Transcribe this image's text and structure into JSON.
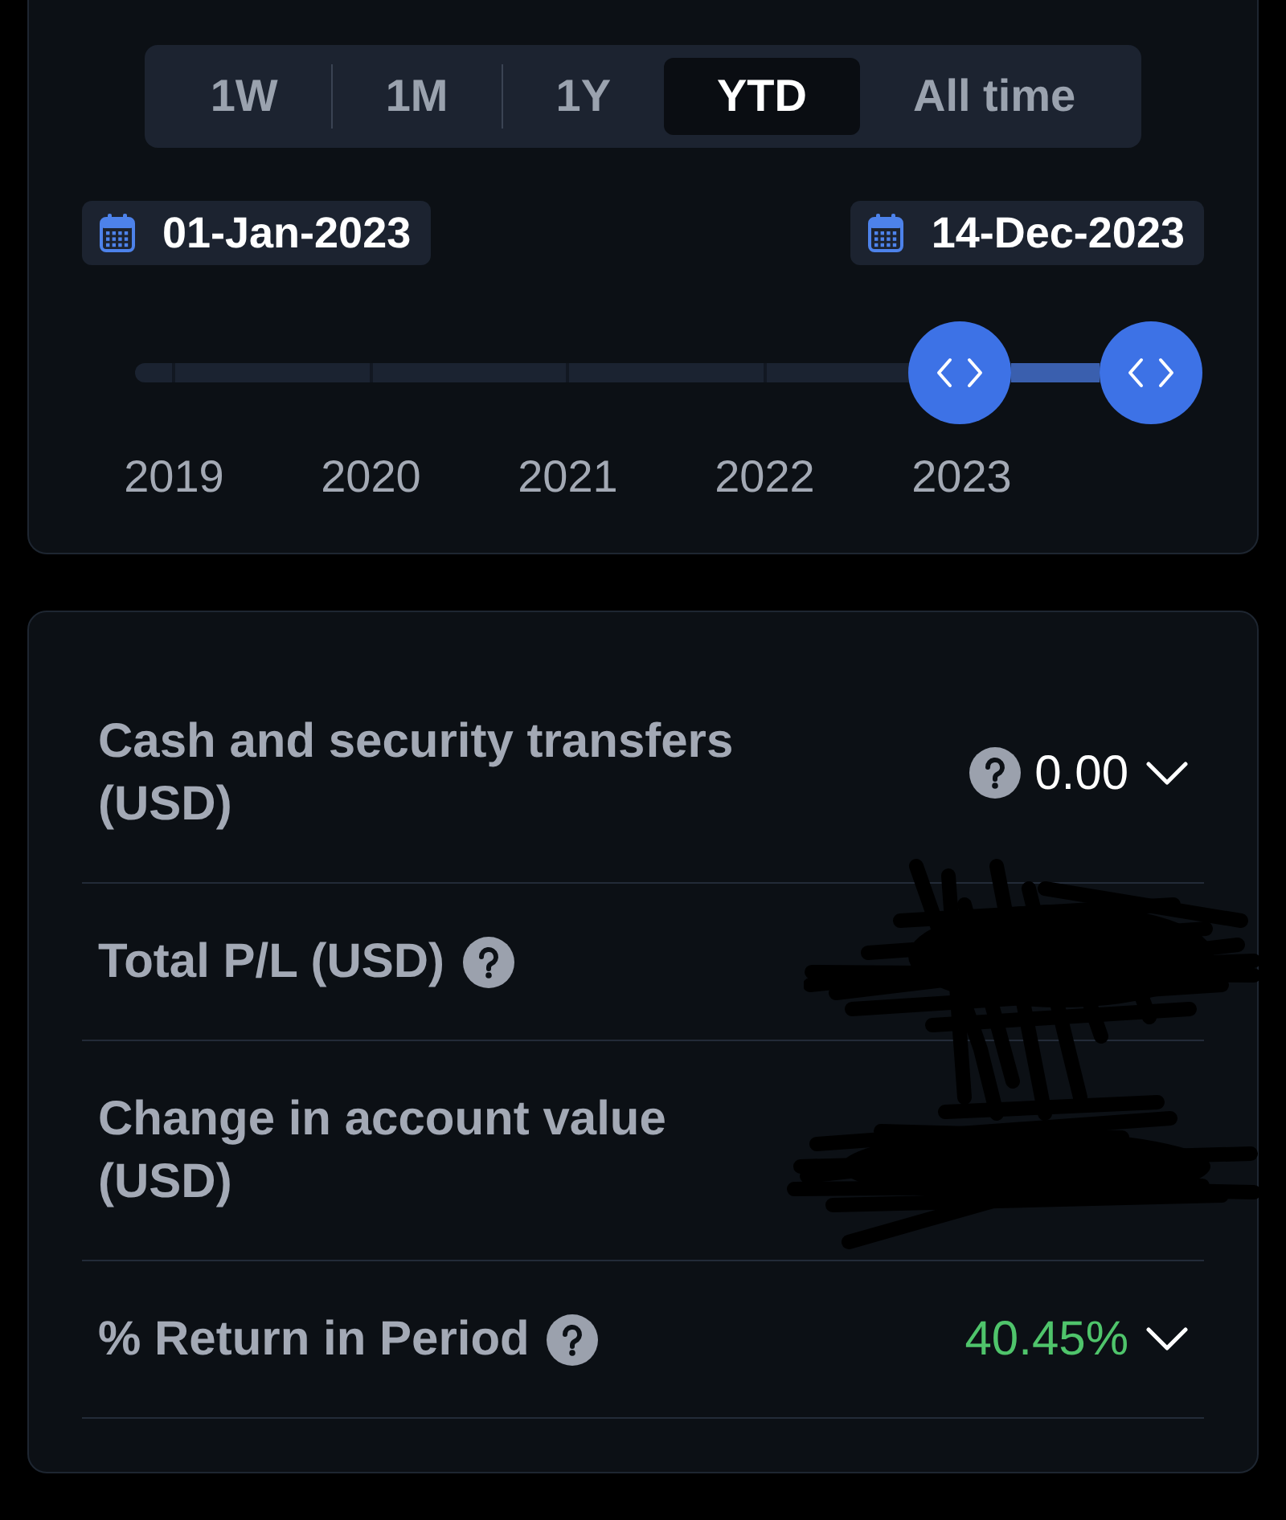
{
  "range_tabs": [
    {
      "label": "1W",
      "selected": false
    },
    {
      "label": "1M",
      "selected": false
    },
    {
      "label": "1Y",
      "selected": false
    },
    {
      "label": "YTD",
      "selected": true
    },
    {
      "label": "All time",
      "selected": false
    }
  ],
  "date_range": {
    "start": "01-Jan-2023",
    "end": "14-Dec-2023"
  },
  "timeline": {
    "thumbs": [
      {
        "level": 0.78
      },
      {
        "level": 0.96
      }
    ],
    "years": [
      "2019",
      "2020",
      "2021",
      "2022",
      "2023"
    ]
  },
  "metrics": [
    {
      "label": "Cash and security transfers (USD)",
      "label_help": false,
      "value_help": true,
      "value": "0.00",
      "color": "#ffffff",
      "expandable": true,
      "redacted": false
    },
    {
      "label": "Total P/L (USD)",
      "label_help": true,
      "value_help": false,
      "expandable": false,
      "redacted": true
    },
    {
      "label": "Change in account value (USD)",
      "label_help": false,
      "value_help": false,
      "expandable": false,
      "redacted": true
    },
    {
      "label": "% Return in Period",
      "label_help": true,
      "value_help": false,
      "value": "40.45%",
      "color": "#4fc46b",
      "expandable": true,
      "redacted": false
    }
  ]
}
